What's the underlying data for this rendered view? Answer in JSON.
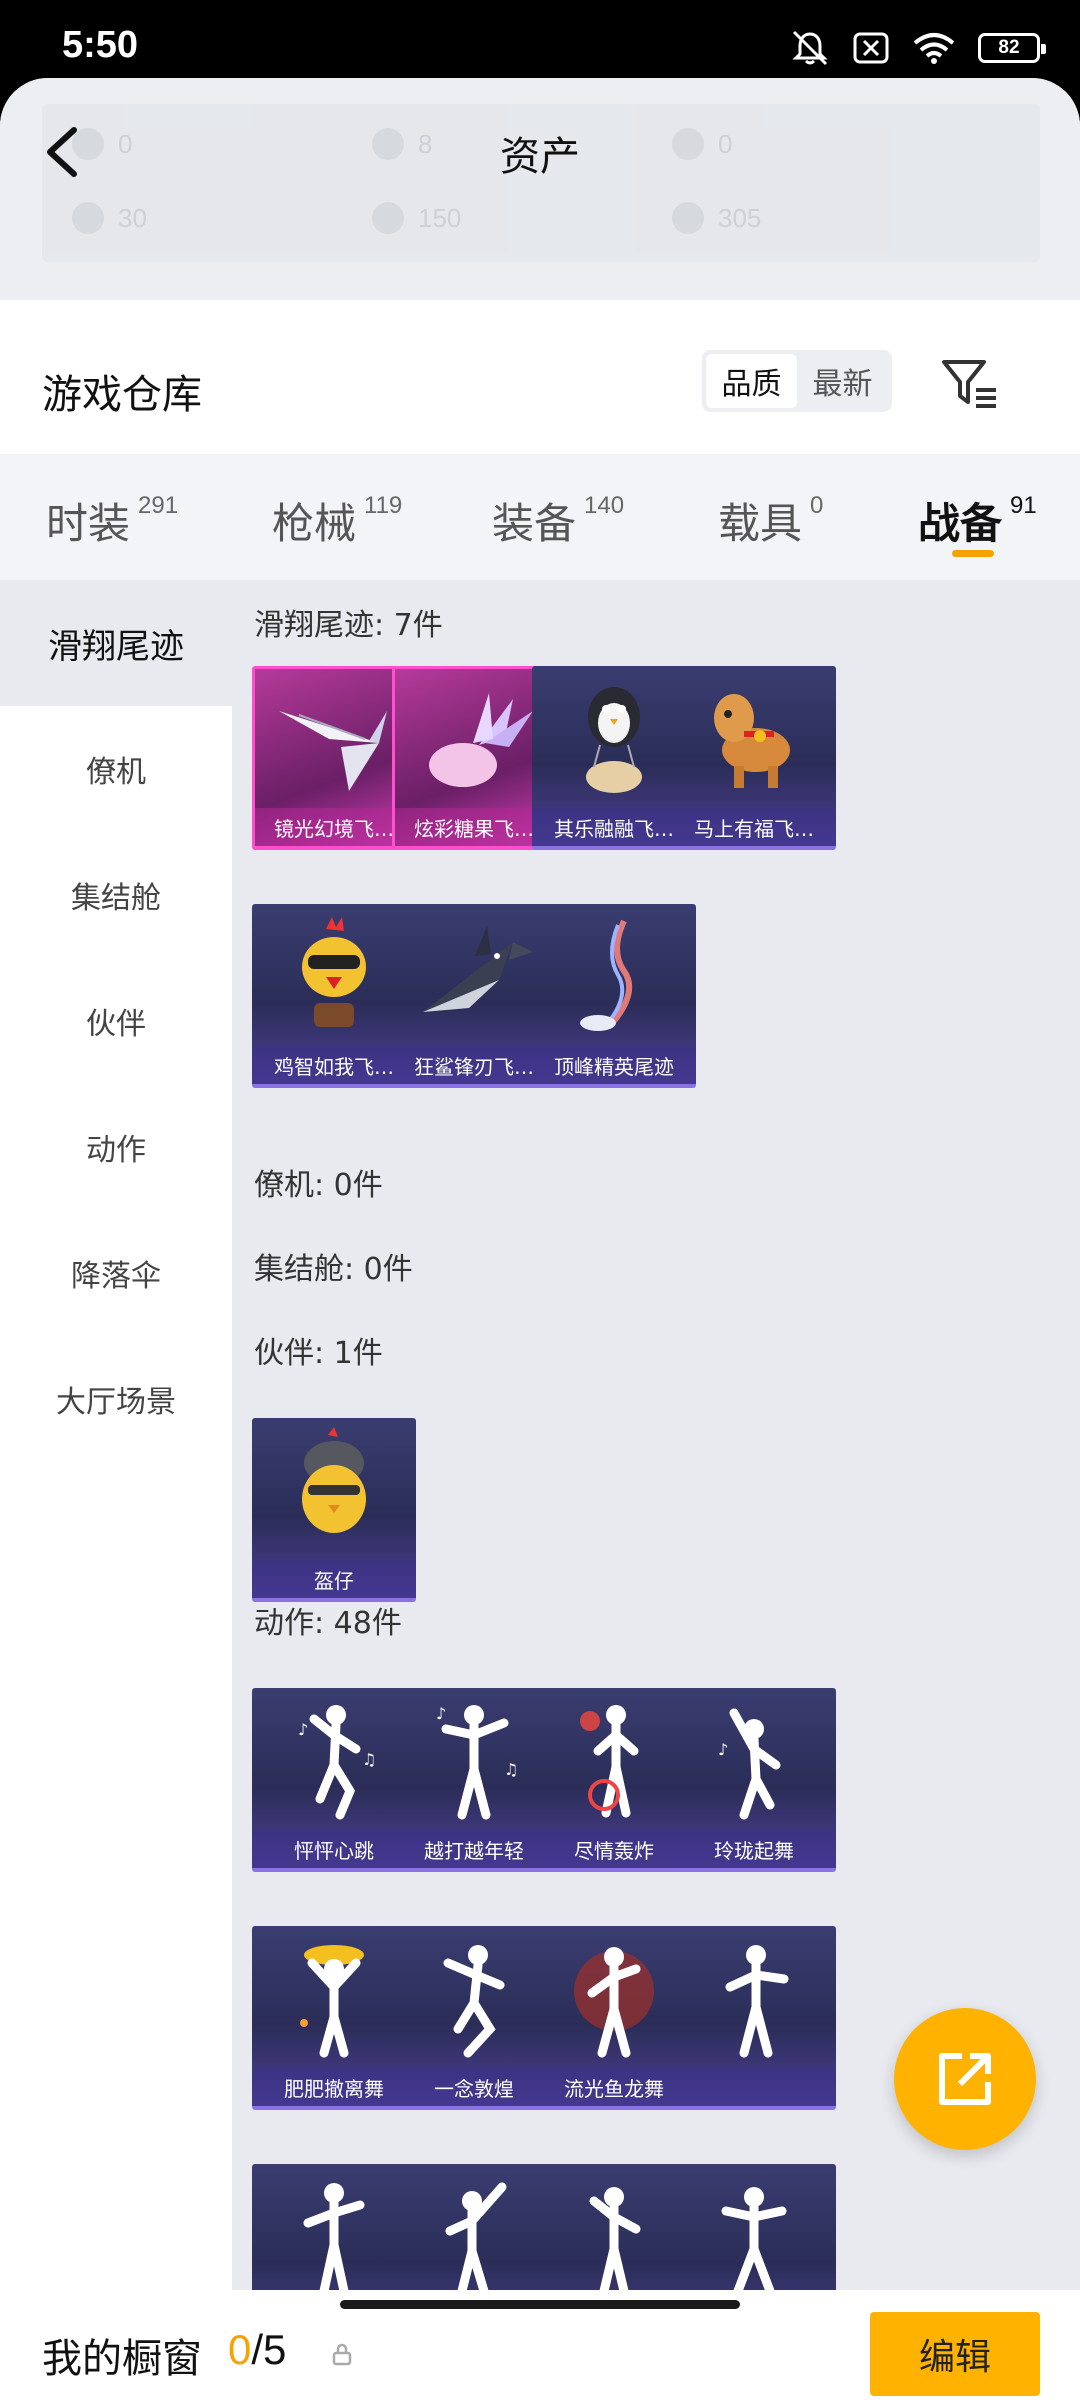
{
  "status": {
    "time": "5:50",
    "battery": "82"
  },
  "header": {
    "title": "资产",
    "assets": [
      {
        "value": "0"
      },
      {
        "value": "8"
      },
      {
        "value": "0"
      },
      {
        "value": "30"
      },
      {
        "value": "150"
      },
      {
        "value": "305"
      }
    ]
  },
  "warehouse": {
    "title": "游戏仓库",
    "sort_options": [
      "品质",
      "最新"
    ]
  },
  "tabs": [
    {
      "label": "时装",
      "count": "291"
    },
    {
      "label": "枪械",
      "count": "119"
    },
    {
      "label": "装备",
      "count": "140"
    },
    {
      "label": "载具",
      "count": "0"
    },
    {
      "label": "战备",
      "count": "91"
    }
  ],
  "sidebar": [
    "滑翔尾迹",
    "僚机",
    "集结舱",
    "伙伴",
    "动作",
    "降落伞",
    "大厅场景"
  ],
  "sections": {
    "glide": {
      "title": "滑翔尾迹: 7件",
      "items": [
        "镜光幻境飞…",
        "炫彩糖果飞…",
        "其乐融融飞…",
        "马上有福飞…",
        "鸡智如我飞…",
        "狂鲨锋刃飞…",
        "顶峰精英尾迹"
      ]
    },
    "wingman": {
      "title": "僚机: 0件"
    },
    "pod": {
      "title": "集结舱: 0件"
    },
    "partner": {
      "title": "伙伴: 1件",
      "items": [
        "盔仔"
      ]
    },
    "emote": {
      "title": "动作: 48件",
      "items": [
        "怦怦心跳",
        "越打越年轻",
        "尽情轰炸",
        "玲珑起舞",
        "肥肥撤离舞",
        "一念敦煌",
        "流光鱼龙舞"
      ]
    }
  },
  "bottom": {
    "label": "我的橱窗",
    "used": "0",
    "sep": "/5",
    "edit": "编辑"
  },
  "colors": {
    "accent": "#ffb200",
    "tab_indicator": "#f5a300",
    "card_bg": "#2b2d58",
    "card_pink": "#b53a9a"
  }
}
